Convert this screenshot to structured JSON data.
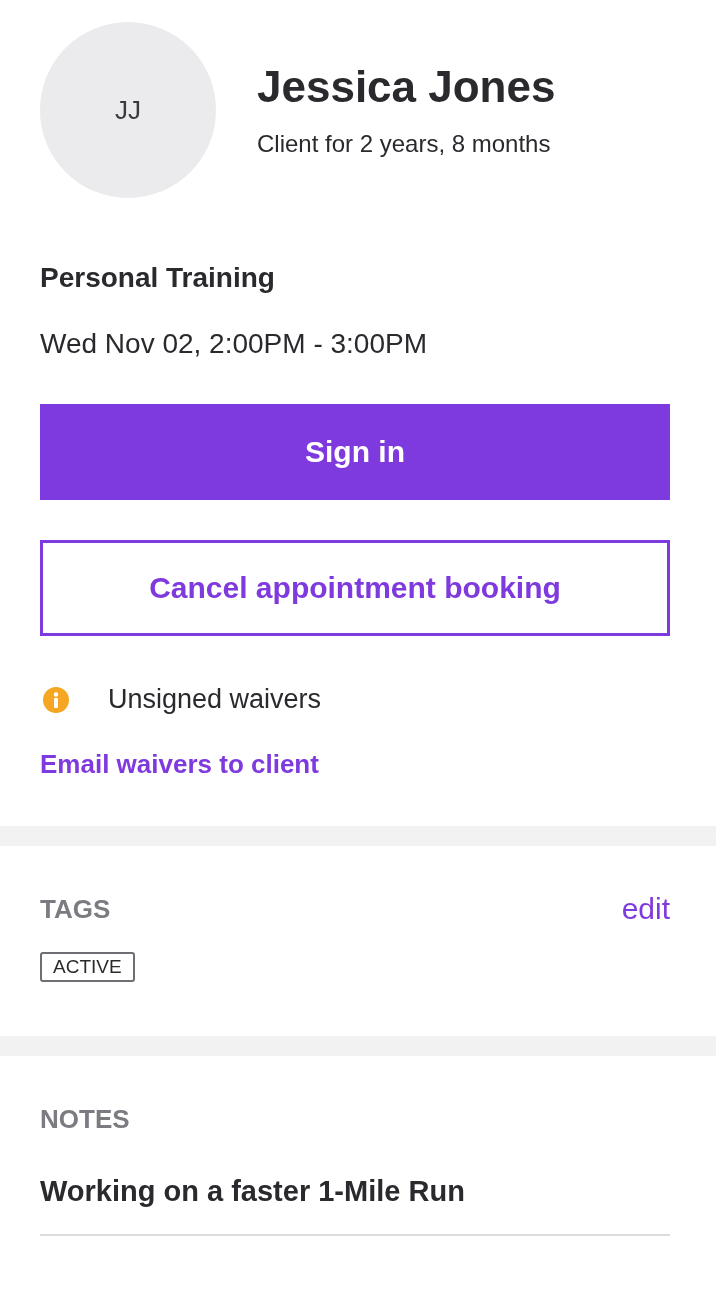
{
  "client": {
    "initials": "JJ",
    "name": "Jessica Jones",
    "tenure": "Client for 2 years, 8 months"
  },
  "appointment": {
    "title": "Personal Training",
    "time": "Wed Nov 02, 2:00PM - 3:00PM"
  },
  "buttons": [
    {
      "label": "Sign in",
      "kind": "primary"
    },
    {
      "label": "Cancel appointment booking",
      "kind": "outline"
    }
  ],
  "waiver_notice": {
    "text": "Unsigned waivers",
    "link": "Email waivers to client"
  },
  "tags": {
    "heading": "TAGS",
    "action": "edit",
    "items": [
      "ACTIVE"
    ]
  },
  "notes": {
    "heading": "NOTES",
    "items": [
      "Working on a faster 1-Mile Run"
    ]
  }
}
